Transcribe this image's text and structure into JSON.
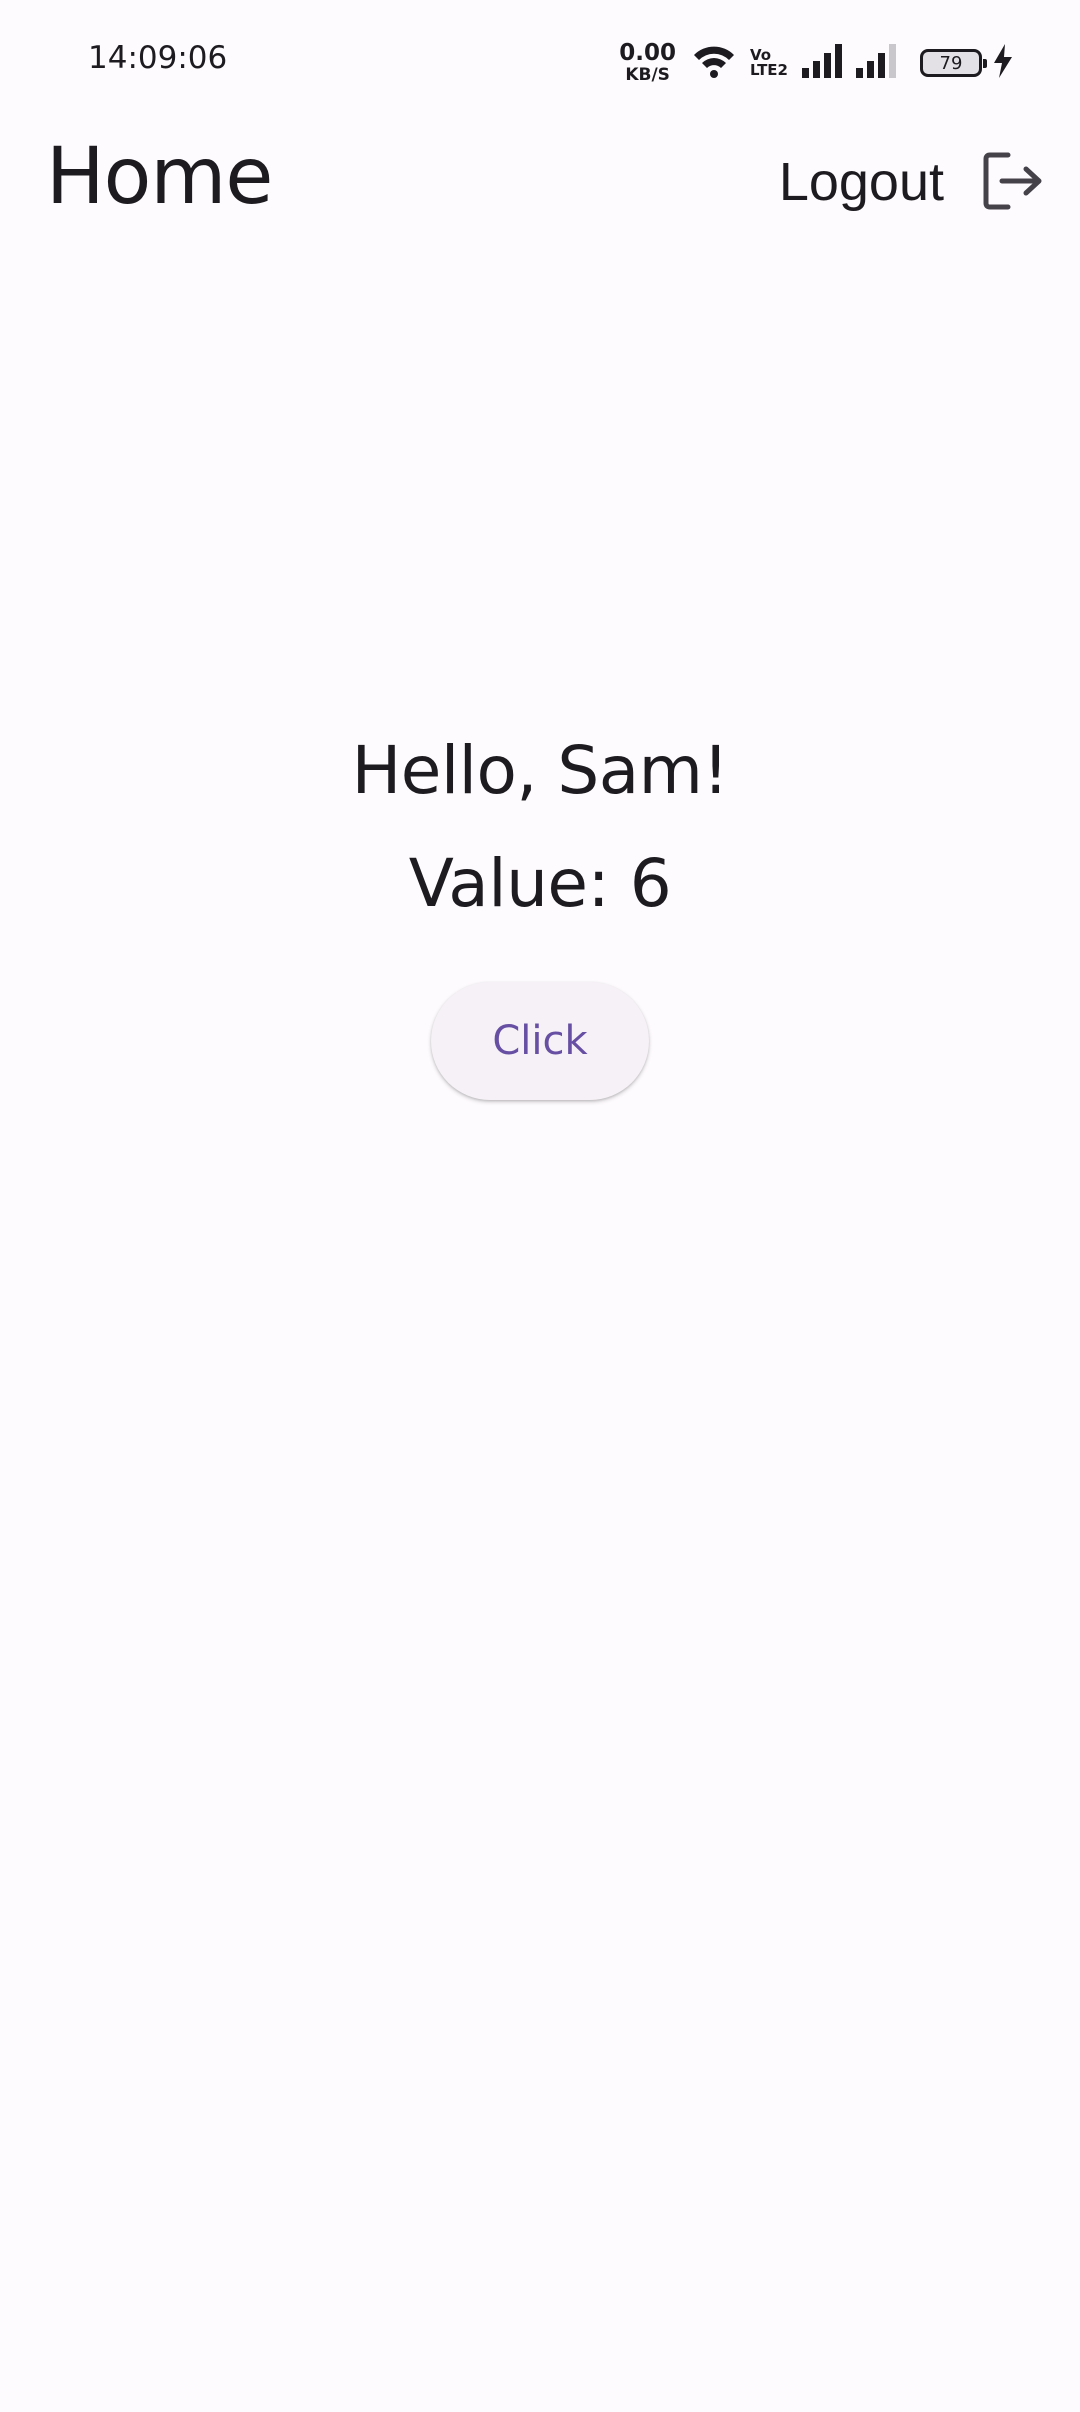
{
  "status_bar": {
    "time": "14:09:06",
    "net_speed_value": "0.00",
    "net_speed_unit": "KB/S",
    "volte_top": "Vo",
    "volte_bottom": "LTE2",
    "battery_level": "79",
    "icons": [
      "wifi-icon",
      "signal-icon",
      "signal-icon",
      "battery-icon",
      "charging-icon"
    ]
  },
  "app_bar": {
    "title": "Home",
    "logout_label": "Logout",
    "logout_icon": "logout-icon"
  },
  "main": {
    "greeting": "Hello, Sam!",
    "value_text": "Value: 6",
    "button_label": "Click"
  },
  "colors": {
    "background": "#fefbfe",
    "text": "#1d1b20",
    "accent": "#6750a4",
    "button_surface": "#f5f1f6"
  }
}
